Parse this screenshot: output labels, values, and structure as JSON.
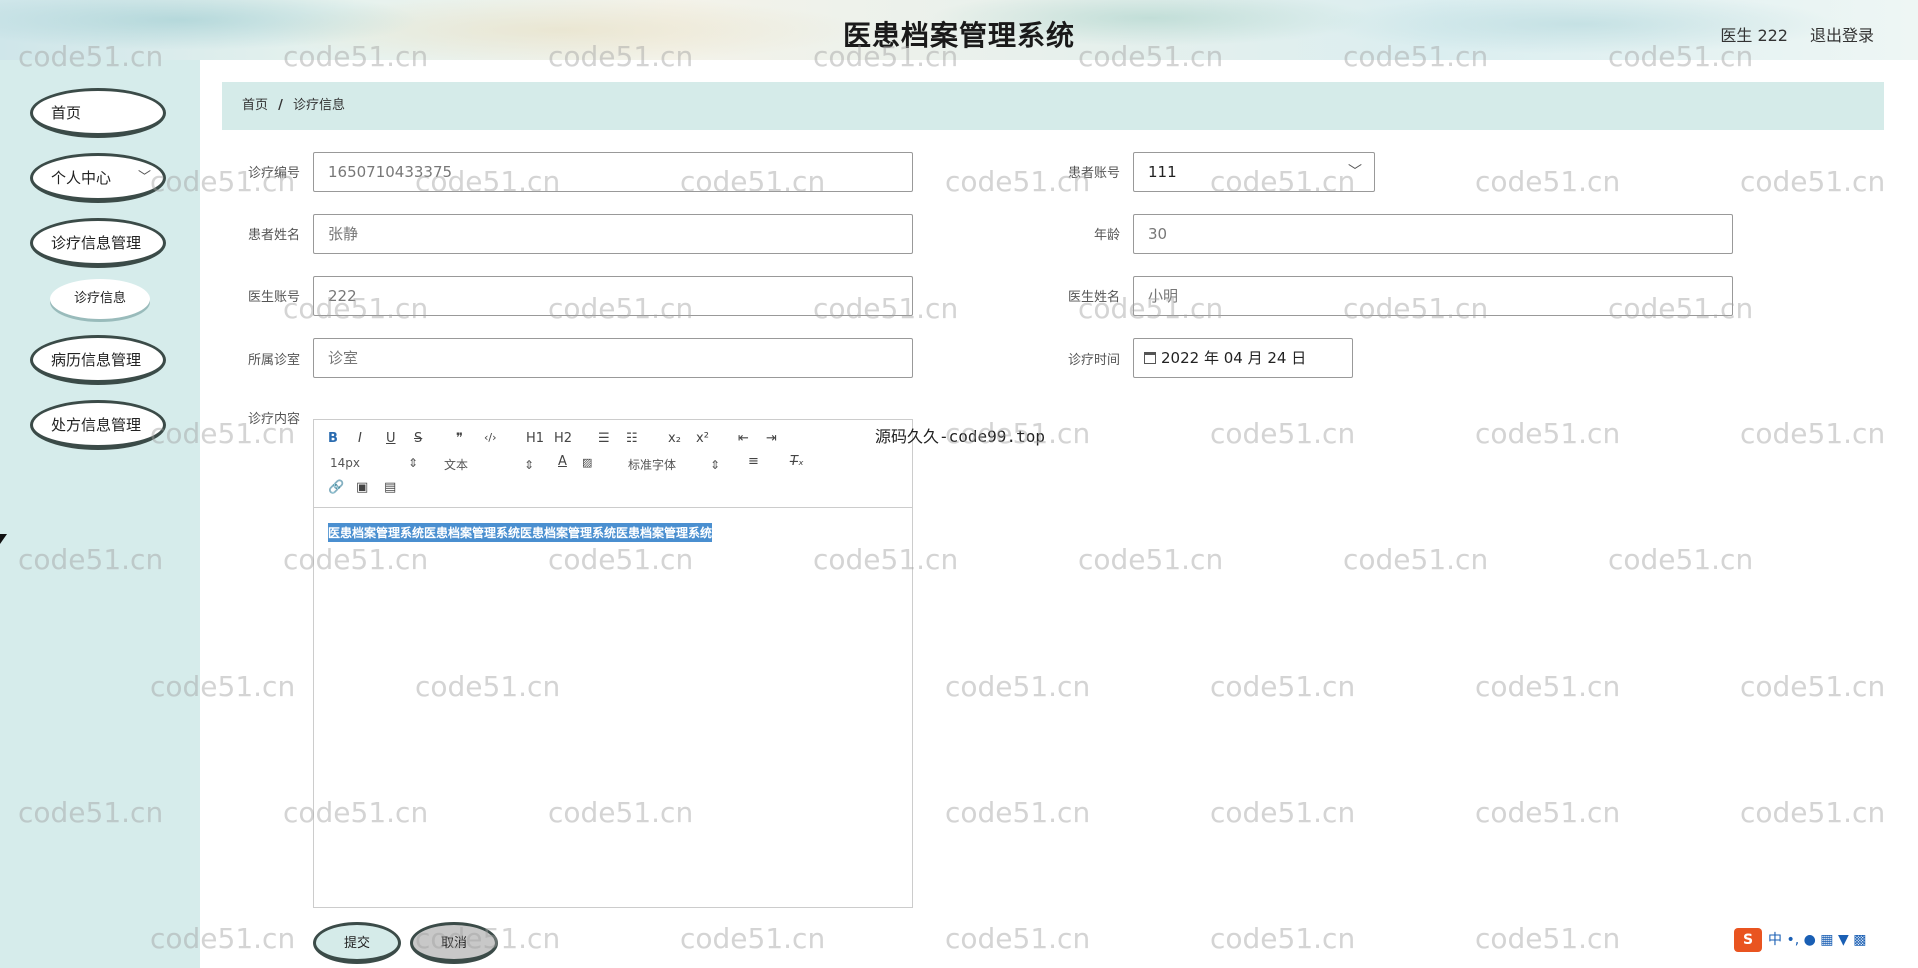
{
  "header": {
    "title": "医患档案管理系统",
    "user": "医生 222",
    "logout": "退出登录"
  },
  "sidebar": {
    "items": [
      {
        "label": "首页"
      },
      {
        "label": "个人中心",
        "chevron": "chevron-down-icon"
      },
      {
        "label": "诊疗信息管理"
      },
      {
        "label": "诊疗信息",
        "sub": true
      },
      {
        "label": "病历信息管理"
      },
      {
        "label": "处方信息管理"
      }
    ]
  },
  "breadcrumb": {
    "home": "首页",
    "separator": "/",
    "current": "诊疗信息"
  },
  "form": {
    "diag_no_label": "诊疗编号",
    "diag_no": "1650710433375",
    "patient_acct_label": "患者账号",
    "patient_acct": "111",
    "patient_name_label": "患者姓名",
    "patient_name": "张静",
    "age_label": "年龄",
    "age": "30",
    "doctor_acct_label": "医生账号",
    "doctor_acct": "222",
    "doctor_name_label": "医生姓名",
    "doctor_name": "小明",
    "clinic_label": "所属诊室",
    "clinic": "诊室",
    "diag_time_label": "诊疗时间",
    "diag_time": "2022 年 04 月 24 日",
    "content_label": "诊疗内容"
  },
  "editor": {
    "toolbar_row1": [
      "B",
      "I",
      "U",
      "S",
      "❞",
      "‹/›",
      "H1",
      "H2",
      "☰",
      "☷",
      "x₂",
      "x²",
      "⇤",
      "⇥"
    ],
    "font_size": "14px",
    "block_type": "文本",
    "font_family": "标准字体",
    "content": "医患档案管理系统医患档案管理系统医患档案管理系统医患档案管理系统"
  },
  "overlay_text": "源码久久-code99.top",
  "buttons": {
    "submit": "提交",
    "cancel": "取消"
  },
  "watermark": "code51.cn",
  "ime": {
    "lang": "中"
  },
  "colors": {
    "sidebar": "#d6eceb",
    "breadcrumb": "#d5ebe9",
    "highlight": "#4a8fd0"
  }
}
